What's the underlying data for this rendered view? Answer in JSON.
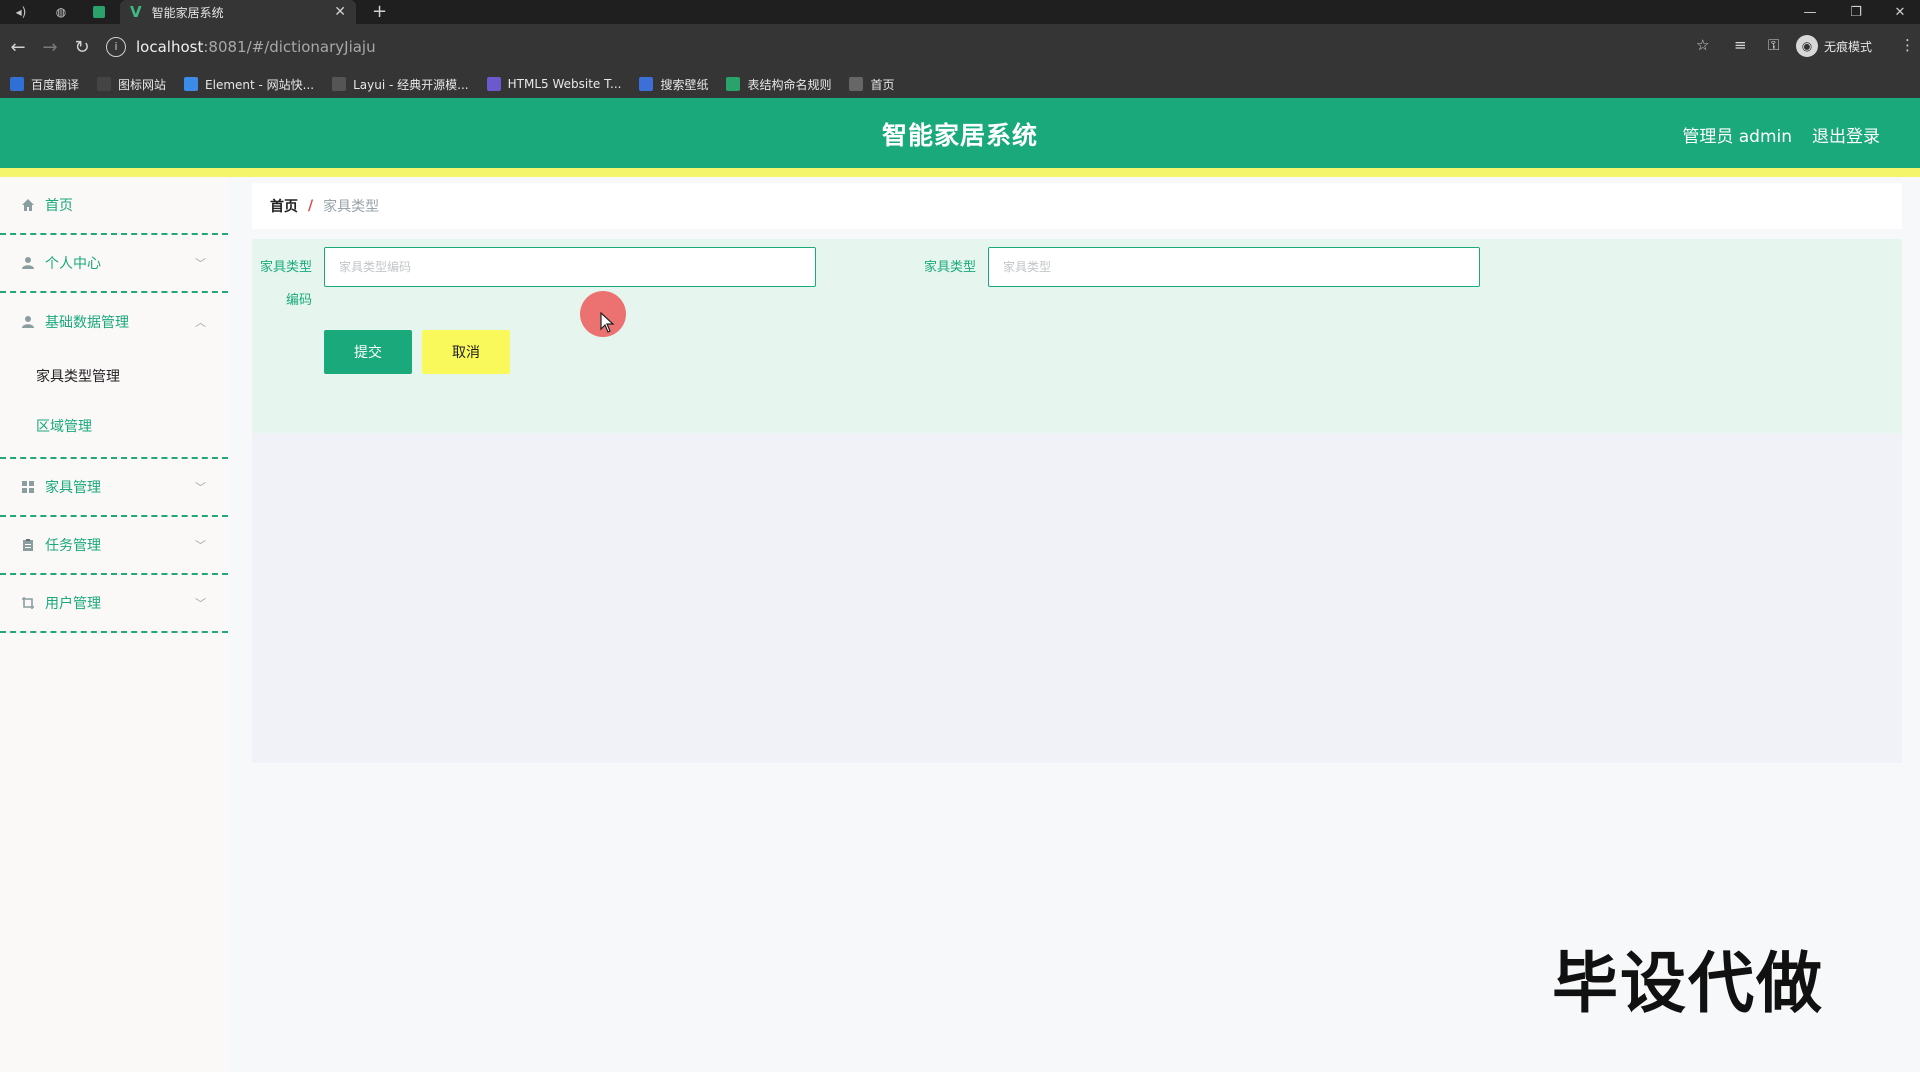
{
  "browser": {
    "tab_title": "智能家居系统",
    "url_host": "localhost",
    "url_path": ":8081/#/dictionaryJiaju",
    "incognito_label": "无痕模式",
    "bookmarks": [
      {
        "label": "百度翻译",
        "color": "#2f6fd6"
      },
      {
        "label": "图标网站",
        "color": "#444444"
      },
      {
        "label": "Element - 网站快...",
        "color": "#3c8ce7"
      },
      {
        "label": "Layui - 经典开源模...",
        "color": "#555555"
      },
      {
        "label": "HTML5 Website T...",
        "color": "#6a5acd"
      },
      {
        "label": "搜索壁纸",
        "color": "#3e6fd8"
      },
      {
        "label": "表结构命名规则",
        "color": "#2aa26b"
      },
      {
        "label": "首页",
        "color": "#666666"
      }
    ]
  },
  "header": {
    "title": "智能家居系统",
    "admin": "管理员 admin",
    "logout": "退出登录",
    "brand_color": "#19a97b",
    "accent_color": "#f4f56a"
  },
  "sidebar": {
    "home": "首页",
    "personal": "个人中心",
    "basic_data": "基础数据管理",
    "basic_sub": [
      "家具类型管理",
      "区域管理"
    ],
    "furniture": "家具管理",
    "tasks": "任务管理",
    "users": "用户管理"
  },
  "breadcrumb": {
    "home": "首页",
    "separator": "/",
    "current": "家具类型"
  },
  "form": {
    "code_label_line1": "家具类型",
    "code_label_line2": "编码",
    "code_placeholder": "家具类型编码",
    "type_label": "家具类型",
    "type_placeholder": "家具类型",
    "submit": "提交",
    "cancel": "取消"
  },
  "watermark": "毕设代做"
}
